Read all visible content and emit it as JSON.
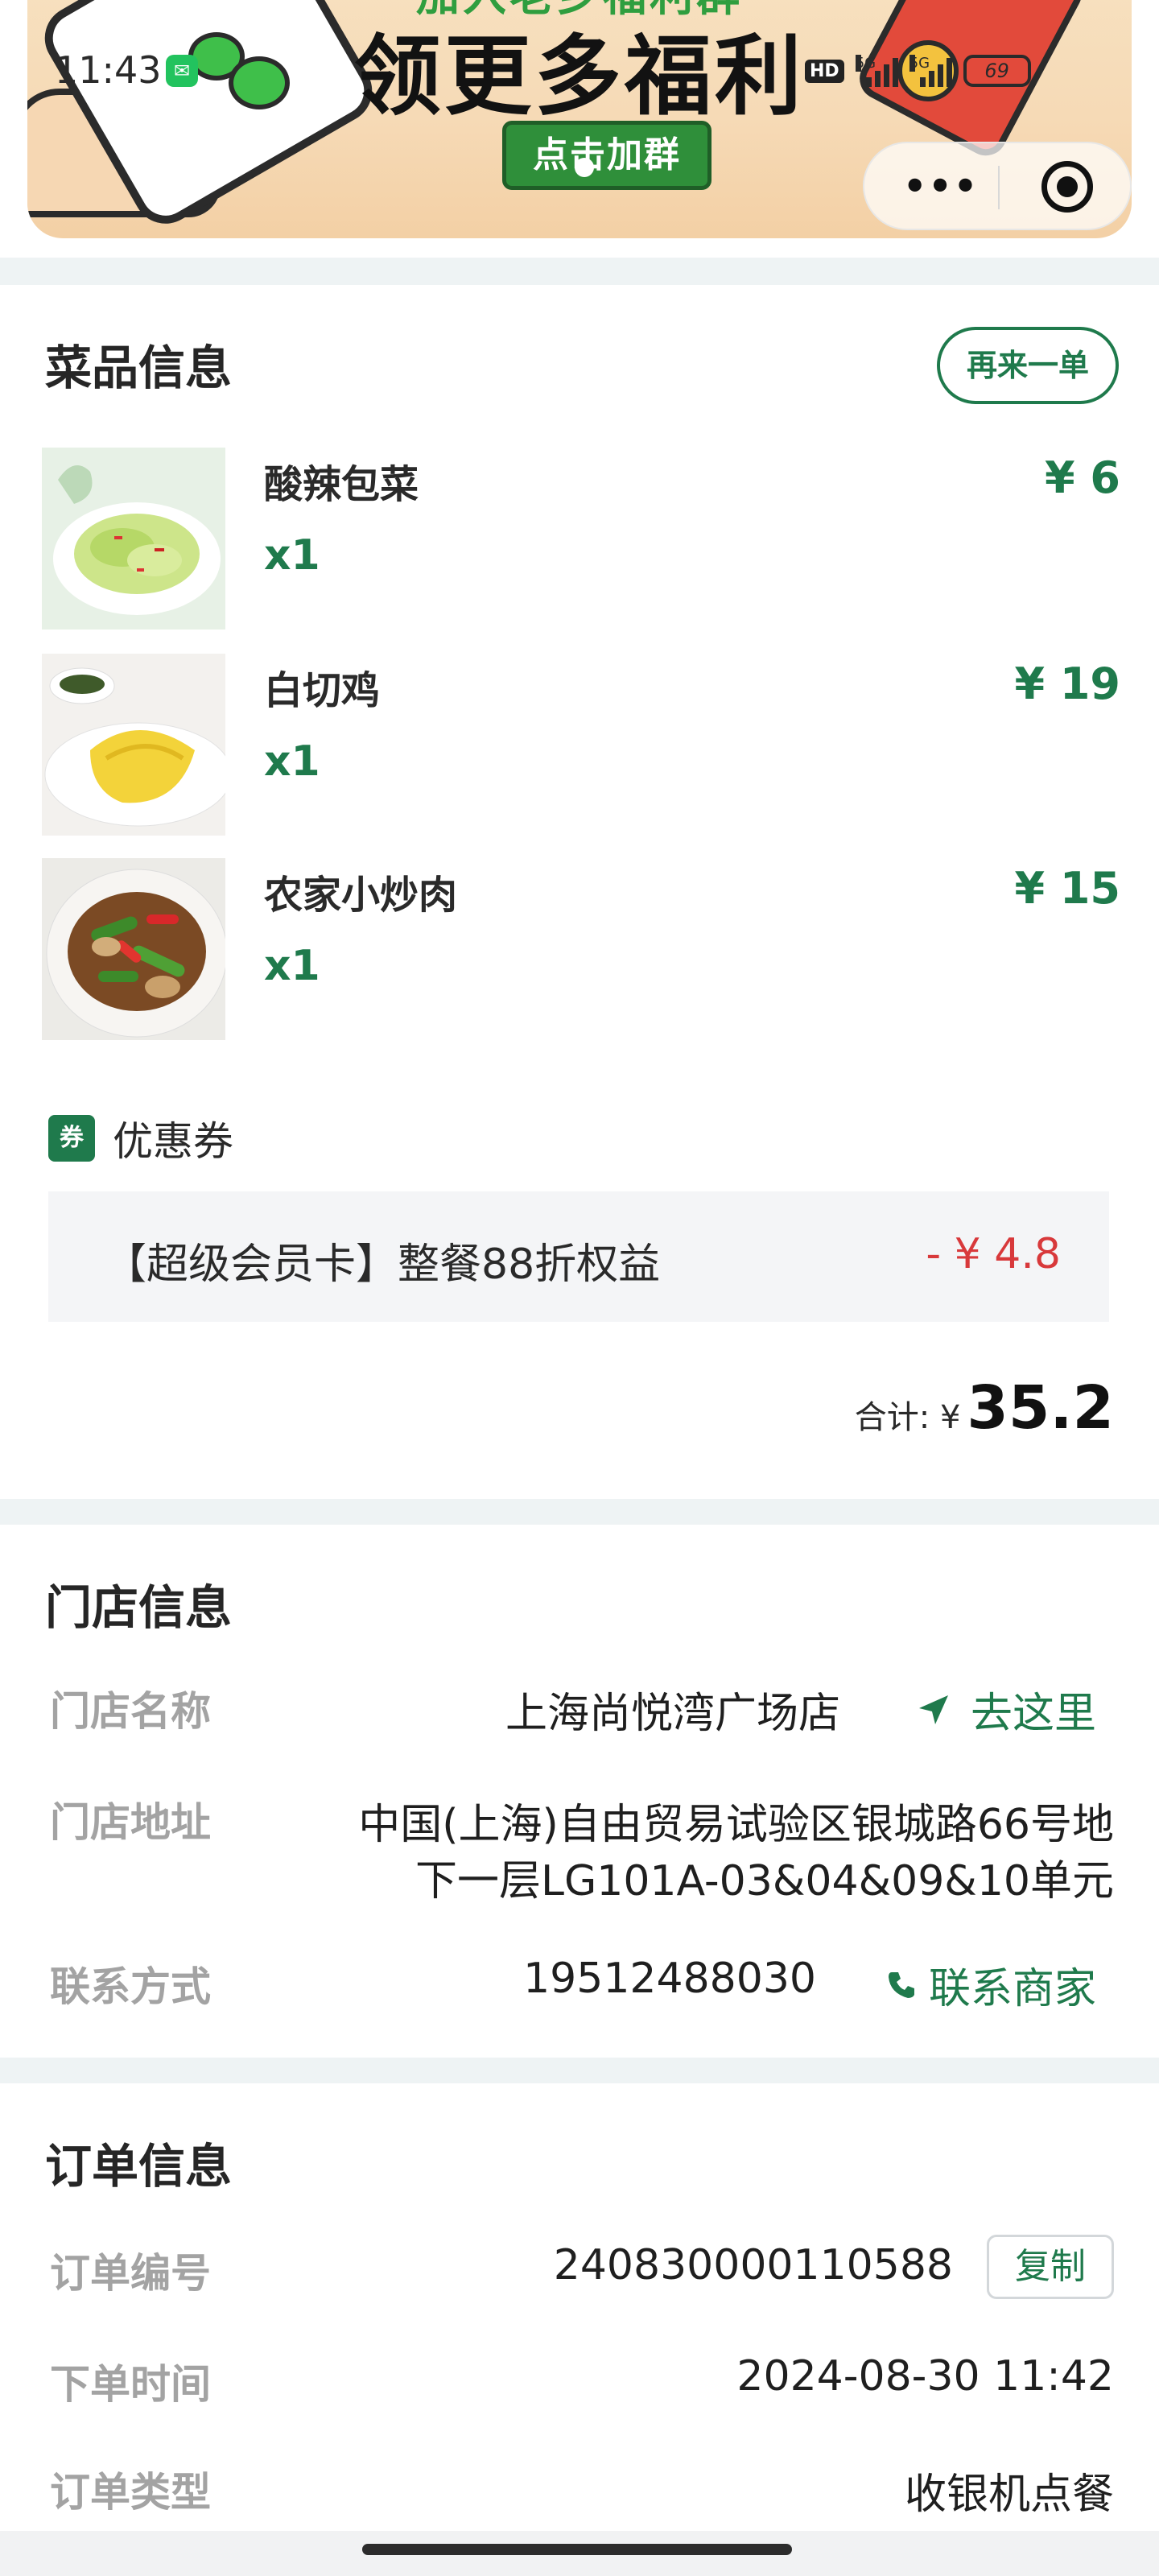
{
  "status_bar": {
    "time": "11:43",
    "network_1": "5G",
    "network_2": "5G",
    "hd": "HD",
    "battery": "69"
  },
  "banner": {
    "headline_top": "加入老乡福利群",
    "headline": "领更多福利",
    "cta": "点击加群"
  },
  "capsule": {
    "more": "•••"
  },
  "dishes_section": {
    "title": "菜品信息",
    "reorder": "再来一单",
    "items": [
      {
        "name": "酸辣包菜",
        "qty": "x1",
        "price": "¥ 6"
      },
      {
        "name": "白切鸡",
        "qty": "x1",
        "price": "¥ 19"
      },
      {
        "name": "农家小炒肉",
        "qty": "x1",
        "price": "¥ 15"
      }
    ],
    "coupon": {
      "icon_text": "券",
      "label": "优惠券",
      "name": "【超级会员卡】整餐88折权益",
      "amount": "- ¥ 4.8"
    },
    "total": {
      "label": "合计: ¥",
      "value": "35.2"
    }
  },
  "store_section": {
    "title": "门店信息",
    "name_key": "门店名称",
    "name_value": "上海尚悦湾广场店",
    "navigate": "去这里",
    "address_key": "门店地址",
    "address_line1": "中国(上海)自由贸易试验区银城路66号地",
    "address_line2": "下一层LG101A-03&04&09&10单元",
    "contact_key": "联系方式",
    "contact_value": "19512488030",
    "contact_action": "联系商家"
  },
  "order_section": {
    "title": "订单信息",
    "number_key": "订单编号",
    "number_value": "240830000110588",
    "copy": "复制",
    "time_key": "下单时间",
    "time_value": "2024-08-30 11:42",
    "type_key": "订单类型",
    "type_value": "收银机点餐"
  },
  "colors": {
    "accent_green": "#1f7a4c",
    "discount_red": "#d8393b",
    "muted_label": "#a3a3a3"
  }
}
